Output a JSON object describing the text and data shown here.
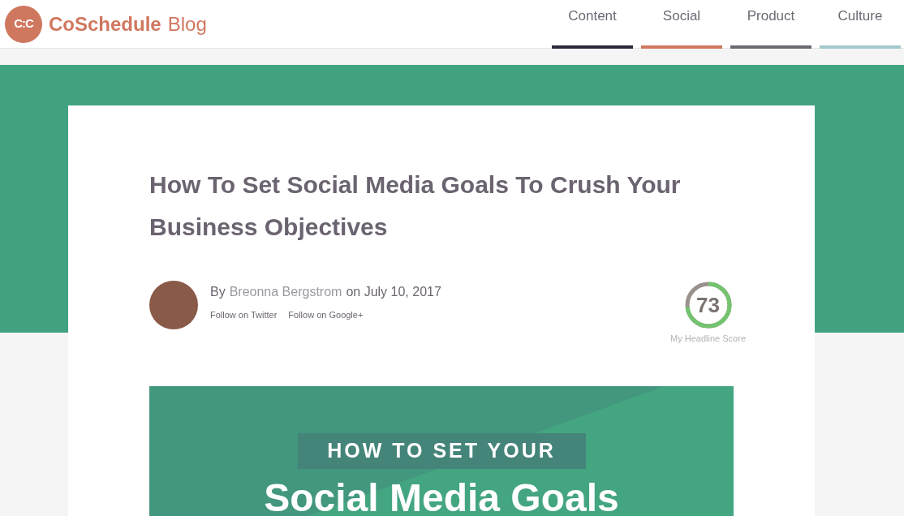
{
  "header": {
    "logo_mark": "C:C",
    "brand": "CoSchedule",
    "section": "Blog"
  },
  "nav": [
    {
      "label": "Content",
      "color": "#2a2a3c"
    },
    {
      "label": "Social",
      "color": "#d0775f"
    },
    {
      "label": "Product",
      "color": "#6d6873"
    },
    {
      "label": "Culture",
      "color": "#a3c7cc"
    }
  ],
  "article": {
    "title": "How To Set Social Media Goals To Crush Your Business Objectives",
    "byline_prefix": "By",
    "author": "Breonna Bergstrom",
    "date_text": "on July 10, 2017",
    "follow_links": [
      "Follow on Twitter",
      "Follow on Google+"
    ],
    "headline_score": {
      "value": "73",
      "level": 0.73,
      "label": "My Headline Score"
    }
  },
  "hero": {
    "kicker": "HOW TO SET YOUR",
    "headline": "Social Media Goals"
  }
}
